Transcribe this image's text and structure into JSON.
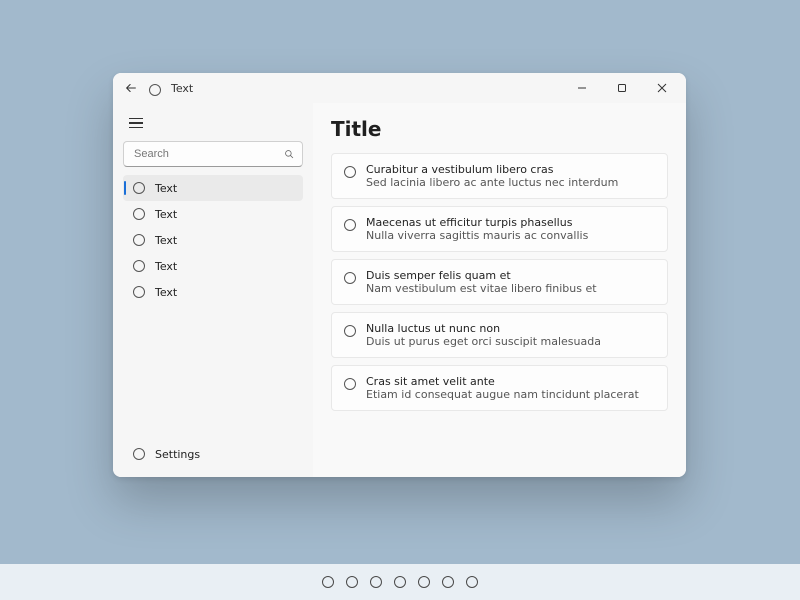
{
  "titlebar": {
    "title": "Text"
  },
  "sidebar": {
    "search_placeholder": "Search",
    "items": [
      {
        "label": "Text",
        "selected": true
      },
      {
        "label": "Text",
        "selected": false
      },
      {
        "label": "Text",
        "selected": false
      },
      {
        "label": "Text",
        "selected": false
      },
      {
        "label": "Text",
        "selected": false
      }
    ],
    "settings_label": "Settings"
  },
  "content": {
    "title": "Title",
    "cards": [
      {
        "line1": "Curabitur a vestibulum libero cras",
        "line2": "Sed lacinia libero ac ante luctus nec interdum"
      },
      {
        "line1": "Maecenas ut efficitur turpis phasellus",
        "line2": "Nulla viverra sagittis mauris ac convallis"
      },
      {
        "line1": "Duis semper felis quam et",
        "line2": "Nam vestibulum est vitae libero finibus et"
      },
      {
        "line1": "Nulla luctus ut nunc non",
        "line2": "Duis ut purus eget orci suscipit malesuada"
      },
      {
        "line1": "Cras sit amet velit ante",
        "line2": "Etiam id consequat augue nam tincidunt placerat"
      }
    ]
  },
  "pager": {
    "count": 7
  }
}
